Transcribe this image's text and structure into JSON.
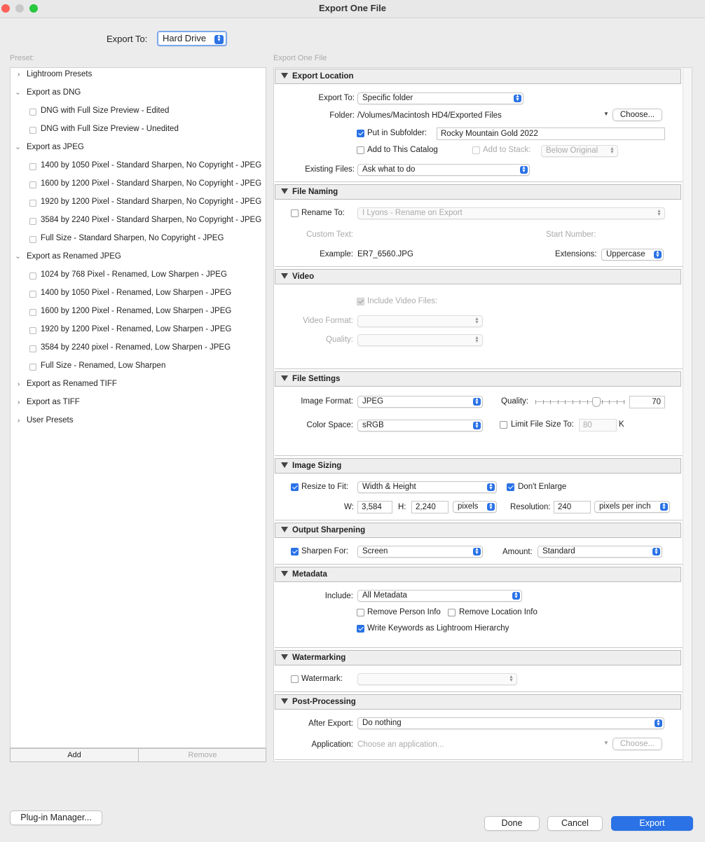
{
  "window": {
    "title": "Export One File"
  },
  "header": {
    "export_to_label": "Export To:",
    "export_to_value": "Hard Drive"
  },
  "presets": {
    "label": "Preset:",
    "groups": [
      {
        "label": "Lightroom Presets"
      },
      {
        "label": "Export as DNG"
      },
      {
        "label": "Export as JPEG"
      },
      {
        "label": "Export as Renamed JPEG"
      },
      {
        "label": "Export as Renamed TIFF"
      },
      {
        "label": "Export as TIFF"
      },
      {
        "label": "User Presets"
      }
    ],
    "items": [
      "DNG with Full Size Preview - Edited",
      "DNG with Full Size Preview - Unedited",
      "1400 by 1050 Pixel - Standard Sharpen, No Copyright - JPEG",
      "1600 by 1200 Pixel - Standard Sharpen, No Copyright - JPEG",
      "1920 by 1200 Pixel - Standard Sharpen, No Copyright - JPEG",
      "3584 by 2240 Pixel - Standard Sharpen, No Copyright - JPEG",
      "Full Size - Standard Sharpen, No Copyright - JPEG",
      "1024 by 768 Pixel - Renamed, Low Sharpen - JPEG",
      "1400 by 1050 Pixel - Renamed, Low Sharpen - JPEG",
      "1600 by 1200 Pixel - Renamed, Low Sharpen - JPEG",
      "1920 by 1200 Pixel - Renamed, Low Sharpen - JPEG",
      "3584 by 2240 pixel - Renamed, Low Sharpen - JPEG",
      "Full Size - Renamed, Low Sharpen"
    ],
    "add_label": "Add",
    "remove_label": "Remove"
  },
  "settings_label": "Export One File",
  "export_location": {
    "title": "Export Location",
    "export_to_label": "Export To:",
    "export_to_value": "Specific folder",
    "folder_label": "Folder:",
    "folder_value": "/Volumes/Macintosh HD4/Exported Files",
    "choose_label": "Choose...",
    "subfolder_label": "Put in Subfolder:",
    "subfolder_checked": true,
    "subfolder_value": "Rocky Mountain Gold 2022",
    "add_catalog_label": "Add to This Catalog",
    "add_stack_label": "Add to Stack:",
    "stack_value": "Below Original",
    "existing_label": "Existing Files:",
    "existing_value": "Ask what to do"
  },
  "file_naming": {
    "title": "File Naming",
    "rename_label": "Rename To:",
    "rename_value": "I Lyons - Rename on Export",
    "custom_text_label": "Custom Text:",
    "start_number_label": "Start Number:",
    "example_label": "Example:",
    "example_value": "ER7_6560.JPG",
    "extensions_label": "Extensions:",
    "extensions_value": "Uppercase"
  },
  "video": {
    "title": "Video",
    "include_label": "Include Video Files:",
    "format_label": "Video Format:",
    "quality_label": "Quality:"
  },
  "file_settings": {
    "title": "File Settings",
    "format_label": "Image Format:",
    "format_value": "JPEG",
    "quality_label": "Quality:",
    "quality_value": "70",
    "quality_level": 70,
    "color_space_label": "Color Space:",
    "color_space_value": "sRGB",
    "limit_label": "Limit File Size To:",
    "limit_value": "80",
    "limit_unit": "K"
  },
  "image_sizing": {
    "title": "Image Sizing",
    "resize_label": "Resize to Fit:",
    "resize_value": "Width & Height",
    "enlarge_label": "Don't Enlarge",
    "w_label": "W:",
    "w_value": "3,584",
    "h_label": "H:",
    "h_value": "2,240",
    "unit_value": "pixels",
    "resolution_label": "Resolution:",
    "resolution_value": "240",
    "resolution_unit": "pixels per inch"
  },
  "output_sharpening": {
    "title": "Output Sharpening",
    "sharpen_label": "Sharpen For:",
    "sharpen_value": "Screen",
    "amount_label": "Amount:",
    "amount_value": "Standard"
  },
  "metadata": {
    "title": "Metadata",
    "include_label": "Include:",
    "include_value": "All Metadata",
    "remove_person_label": "Remove Person Info",
    "remove_location_label": "Remove Location Info",
    "keywords_label": "Write Keywords as Lightroom Hierarchy"
  },
  "watermarking": {
    "title": "Watermarking",
    "watermark_label": "Watermark:"
  },
  "post_processing": {
    "title": "Post-Processing",
    "after_label": "After Export:",
    "after_value": "Do nothing",
    "app_label": "Application:",
    "app_placeholder": "Choose an application...",
    "choose_label": "Choose..."
  },
  "footer": {
    "plugin_label": "Plug-in Manager...",
    "done_label": "Done",
    "cancel_label": "Cancel",
    "export_label": "Export"
  },
  "colors": {
    "accent": "#2a72e6",
    "close": "#fe5f57",
    "minimize": "#febc2e",
    "zoom": "#28c840"
  }
}
